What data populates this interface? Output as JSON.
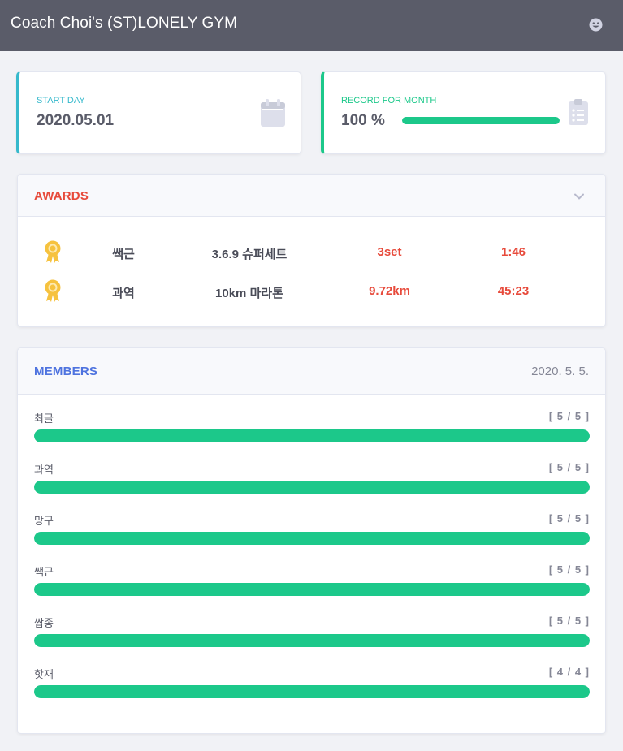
{
  "app": {
    "title": "Coach Choi's (ST)LONELY GYM",
    "user_icon": "smiley-face-icon"
  },
  "colors": {
    "topbar": "#5a5c69",
    "info": "#36b9cc",
    "success": "#1cc88a",
    "danger": "#e74a3b",
    "primary": "#4e73df",
    "gold": "#f6c23e"
  },
  "start_card": {
    "label": "START DAY",
    "value": "2020.05.01",
    "icon": "calendar-icon"
  },
  "record_card": {
    "label": "RECORD FOR MONTH",
    "value": "100 %",
    "progress": 100,
    "icon": "clipboard-list-icon"
  },
  "awards": {
    "title": "AWARDS",
    "toggle_icon": "chevron-down-icon",
    "rows": [
      {
        "icon": "award-medal-icon",
        "name": "쌕근",
        "event": "3.6.9 슈퍼세트",
        "score": "3set",
        "time": "1:46"
      },
      {
        "icon": "award-medal-icon",
        "name": "과역",
        "event": "10km 마라톤",
        "score": "9.72km",
        "time": "45:23"
      }
    ]
  },
  "members": {
    "title": "MEMBERS",
    "date": "2020. 5. 5.",
    "rows": [
      {
        "name": "최글",
        "count": "[ 5 / 5 ]",
        "progress": 1.0
      },
      {
        "name": "과역",
        "count": "[ 5 / 5 ]",
        "progress": 1.0
      },
      {
        "name": "망구",
        "count": "[ 5 / 5 ]",
        "progress": 1.0
      },
      {
        "name": "쌕근",
        "count": "[ 5 / 5 ]",
        "progress": 1.0
      },
      {
        "name": "쌉종",
        "count": "[ 5 / 5 ]",
        "progress": 1.0
      },
      {
        "name": "핫재",
        "count": "[ 4 / 4 ]",
        "progress": 1.0
      }
    ]
  }
}
